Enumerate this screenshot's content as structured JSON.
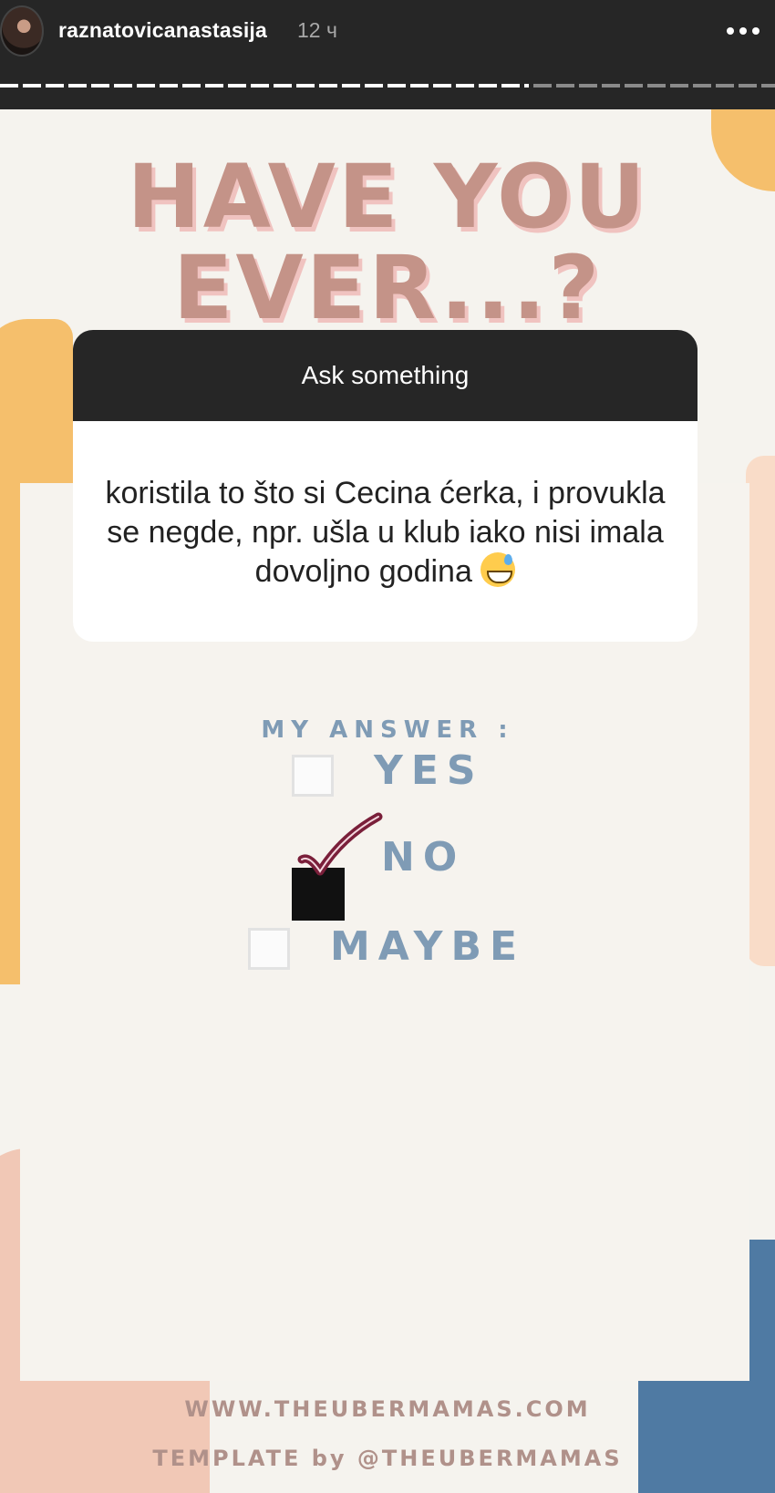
{
  "header": {
    "username": "raznatovicanastasija",
    "time": "12 ч",
    "more_icon": "more-horizontal-icon"
  },
  "story": {
    "title_line1": "HAVE YOU",
    "title_line2": "EVER...?",
    "sticker": {
      "header": "Ask something",
      "question": "koristila to što si Cecina ćerka, i provukla se negde, npr. ušla u klub iako nisi imala dovoljno godina"
    },
    "answer_label": "MY ANSWER :",
    "options": [
      {
        "label": "YES",
        "checked": false
      },
      {
        "label": "NO",
        "checked": true
      },
      {
        "label": "MAYBE",
        "checked": false
      }
    ],
    "footer_url": "WWW.THEUBERMAMAS.COM",
    "footer_credit": "TEMPLATE by @THEUBERMAMAS"
  },
  "colors": {
    "title": "#c49388",
    "answer_text": "#7f9bb5",
    "check": "#7a1f3a"
  }
}
